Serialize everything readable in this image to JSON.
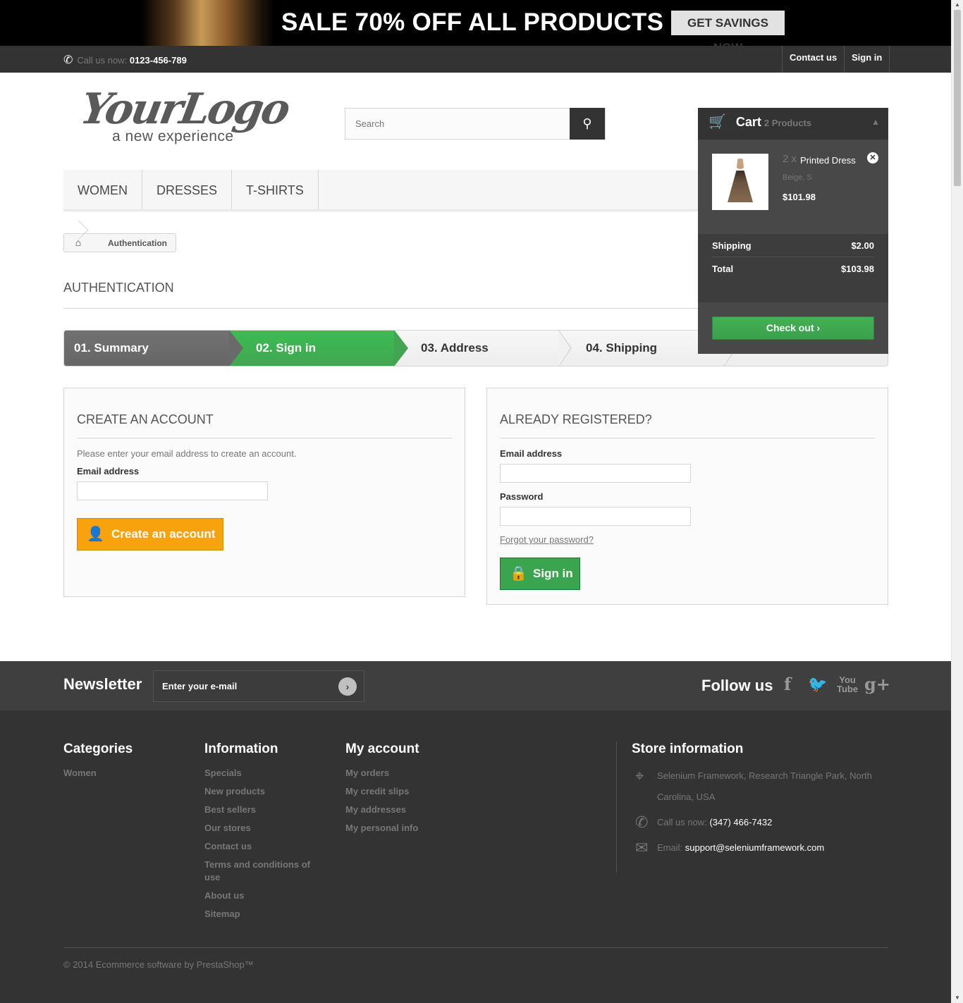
{
  "banner": {
    "text": "SALE 70% OFF ALL PRODUCTS",
    "cta": "GET SAVINGS NOW"
  },
  "topbar": {
    "call_label": "Call us now:",
    "phone": "0123-456-789",
    "contact": "Contact us",
    "signin": "Sign in"
  },
  "logo": {
    "main": "YourLogo",
    "tagline": "a new experience"
  },
  "search": {
    "placeholder": "Search"
  },
  "menu": [
    "WOMEN",
    "DRESSES",
    "T-SHIRTS"
  ],
  "breadcrumb": {
    "current": "Authentication"
  },
  "page_title": "AUTHENTICATION",
  "steps": [
    "01. Summary",
    "02. Sign in",
    "03. Address",
    "04. Shipping"
  ],
  "create": {
    "title": "CREATE AN ACCOUNT",
    "intro": "Please enter your email address to create an account.",
    "email_label": "Email address",
    "button": "Create an account"
  },
  "login": {
    "title": "ALREADY REGISTERED?",
    "email_label": "Email address",
    "password_label": "Password",
    "forgot": "Forgot your password?",
    "button": "Sign in"
  },
  "cart": {
    "title": "Cart",
    "count": "2 Products",
    "item": {
      "qty": "2 x",
      "name": "Printed Dress",
      "attrs": "Beige, S",
      "price": "$101.98"
    },
    "shipping_label": "Shipping",
    "shipping": "$2.00",
    "total_label": "Total",
    "total": "$103.98",
    "checkout": "Check out"
  },
  "newsletter": {
    "title": "Newsletter",
    "placeholder": "Enter your e-mail",
    "follow": "Follow us"
  },
  "footer": {
    "categories": {
      "title": "Categories",
      "items": [
        "Women"
      ]
    },
    "information": {
      "title": "Information",
      "items": [
        "Specials",
        "New products",
        "Best sellers",
        "Our stores",
        "Contact us",
        "Terms and conditions of use",
        "About us",
        "Sitemap"
      ]
    },
    "account": {
      "title": "My account",
      "items": [
        "My orders",
        "My credit slips",
        "My addresses",
        "My personal info"
      ]
    },
    "store": {
      "title": "Store information",
      "address": "Selenium Framework, Research Triangle Park, North Carolina, USA",
      "call_label": "Call us now:",
      "phone": "(347) 466-7432",
      "email_label": "Email:",
      "email": "support@seleniumframework.com"
    },
    "copyright": "© 2014 Ecommerce software by PrestaShop™"
  },
  "colors": {
    "accent_green": "#46a74e",
    "accent_orange": "#f8a30d",
    "dark": "#333333"
  }
}
